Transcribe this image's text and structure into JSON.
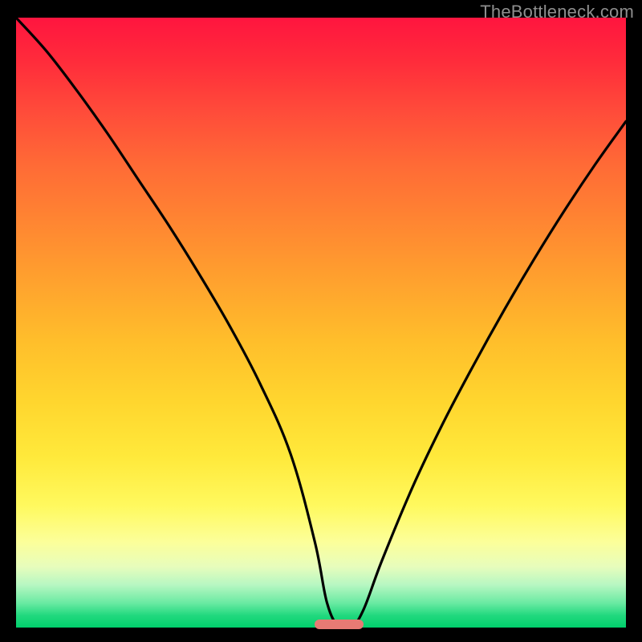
{
  "watermark": "TheBottleneck.com",
  "colors": {
    "background": "#000000",
    "curve": "#000000",
    "marker": "#e87a74",
    "gradient_top": "#ff153f",
    "gradient_bottom": "#00cf6c"
  },
  "chart_data": {
    "type": "line",
    "title": "",
    "xlabel": "",
    "ylabel": "",
    "xlim": [
      0,
      100
    ],
    "ylim": [
      0,
      100
    ],
    "description": "Bottleneck curve: steep descent from upper-left reaching a minimum (≈0) centered around x≈53, then rising toward upper-right. Background is a vertical heat gradient (red=high bottleneck at top, green=low at bottom).",
    "series": [
      {
        "name": "bottleneck-curve",
        "x": [
          0,
          5,
          10,
          15,
          20,
          25,
          30,
          35,
          40,
          45,
          49,
          51,
          53,
          55,
          57,
          60,
          65,
          70,
          75,
          80,
          85,
          90,
          95,
          100
        ],
        "y": [
          100,
          94.5,
          88,
          81,
          73.5,
          66,
          58,
          49.5,
          40,
          28.5,
          14,
          4,
          0,
          0,
          3,
          11,
          23,
          33.5,
          43,
          52,
          60.5,
          68.5,
          76,
          83
        ]
      }
    ],
    "marker": {
      "x_center": 53,
      "y": 0,
      "width_pct": 8,
      "height_pct": 1.6
    }
  }
}
